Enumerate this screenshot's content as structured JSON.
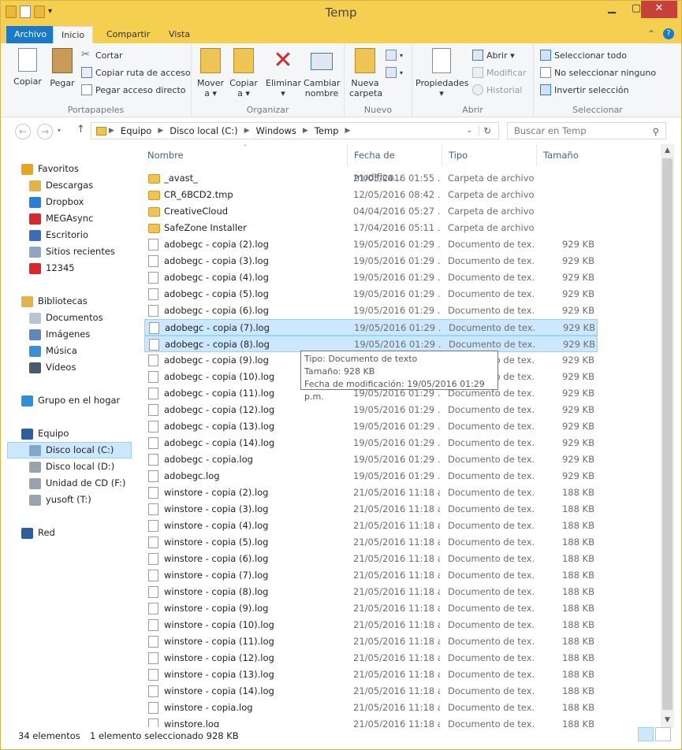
{
  "window": {
    "title": "Temp"
  },
  "tabs": [
    "Archivo",
    "Inicio",
    "Compartir",
    "Vista"
  ],
  "ribbon": {
    "portapapeles": {
      "label": "Portapapeles",
      "copiar": "Copiar",
      "pegar": "Pegar",
      "cortar": "Cortar",
      "copiar_ruta": "Copiar ruta de acceso",
      "pegar_acceso": "Pegar acceso directo"
    },
    "organizar": {
      "label": "Organizar",
      "mover": "Mover",
      "mover_a": "a ▾",
      "copiar": "Copiar",
      "copiar_a": "a ▾",
      "eliminar": "Eliminar",
      "eliminar_arrow": "▾",
      "cambiar": "Cambiar",
      "nombre": "nombre"
    },
    "nuevo": {
      "label": "Nuevo",
      "nueva": "Nueva",
      "carpeta": "carpeta"
    },
    "abrir": {
      "label": "Abrir",
      "propiedades": "Propiedades",
      "abrir": "Abrir ▾",
      "modificar": "Modificar",
      "historial": "Historial"
    },
    "seleccionar": {
      "label": "Seleccionar",
      "todo": "Seleccionar todo",
      "ninguno": "No seleccionar ninguno",
      "invertir": "Invertir selección"
    }
  },
  "address": {
    "crumbs": [
      "Equipo",
      "Disco local (C:)",
      "Windows",
      "Temp"
    ],
    "search_placeholder": "Buscar en Temp"
  },
  "nav": [
    {
      "label": "Favoritos",
      "icon": "star-icon",
      "color": "#e8a524"
    },
    {
      "label": "Descargas",
      "icon": "download-folder-icon",
      "color": "#e3b34a"
    },
    {
      "label": "Dropbox",
      "icon": "dropbox-icon",
      "color": "#2a7fd6"
    },
    {
      "label": "MEGAsync",
      "icon": "mega-icon",
      "color": "#d9272e"
    },
    {
      "label": "Escritorio",
      "icon": "desktop-icon",
      "color": "#3a6fb7"
    },
    {
      "label": "Sitios recientes",
      "icon": "recent-places-icon",
      "color": "#8fa6bf"
    },
    {
      "label": "12345",
      "icon": "mega-icon",
      "color": "#d9272e"
    },
    {
      "label": "Bibliotecas",
      "icon": "libraries-icon",
      "color": "#e3b34a"
    },
    {
      "label": "Documentos",
      "icon": "documents-icon",
      "color": "#b9c4d0"
    },
    {
      "label": "Imágenes",
      "icon": "pictures-icon",
      "color": "#5f87b8"
    },
    {
      "label": "Música",
      "icon": "music-icon",
      "color": "#3d8ed8"
    },
    {
      "label": "Vídeos",
      "icon": "videos-icon",
      "color": "#4a5a6a"
    },
    {
      "label": "Grupo en el hogar",
      "icon": "homegroup-icon",
      "color": "#2f8fd2"
    },
    {
      "label": "Equipo",
      "icon": "computer-icon",
      "color": "#2c5f9e"
    },
    {
      "label": "Disco local (C:)",
      "icon": "drive-c-icon",
      "color": "#7fa8c9"
    },
    {
      "label": "Disco local (D:)",
      "icon": "drive-icon",
      "color": "#9aa3ab"
    },
    {
      "label": "Unidad de CD (F:)",
      "icon": "cd-drive-icon",
      "color": "#9aa3ab"
    },
    {
      "label": "yusoft  (T:)",
      "icon": "network-drive-icon",
      "color": "#9aa3ab"
    },
    {
      "label": "Red",
      "icon": "network-icon",
      "color": "#2c5f9e"
    }
  ],
  "columns": {
    "name": "Nombre",
    "date": "Fecha de modifica...",
    "type": "Tipo",
    "size": "Tamaño"
  },
  "files": [
    {
      "name": "_avast_",
      "date": "21/05/2016 01:55 ...",
      "type": "Carpeta de archivos",
      "size": "",
      "kind": "folder"
    },
    {
      "name": "CR_6BCD2.tmp",
      "date": "12/05/2016 08:42 ...",
      "type": "Carpeta de archivos",
      "size": "",
      "kind": "folder"
    },
    {
      "name": "CreativeCloud",
      "date": "04/04/2016 05:27 ...",
      "type": "Carpeta de archivos",
      "size": "",
      "kind": "folder"
    },
    {
      "name": "SafeZone Installer",
      "date": "17/04/2016 05:11 ...",
      "type": "Carpeta de archivos",
      "size": "",
      "kind": "folder"
    },
    {
      "name": "adobegc - copia (2).log",
      "date": "19/05/2016 01:29 ...",
      "type": "Documento de tex...",
      "size": "929 KB",
      "kind": "file"
    },
    {
      "name": "adobegc - copia (3).log",
      "date": "19/05/2016 01:29 ...",
      "type": "Documento de tex...",
      "size": "929 KB",
      "kind": "file"
    },
    {
      "name": "adobegc - copia (4).log",
      "date": "19/05/2016 01:29 ...",
      "type": "Documento de tex...",
      "size": "929 KB",
      "kind": "file"
    },
    {
      "name": "adobegc - copia (5).log",
      "date": "19/05/2016 01:29 ...",
      "type": "Documento de tex...",
      "size": "929 KB",
      "kind": "file"
    },
    {
      "name": "adobegc - copia (6).log",
      "date": "19/05/2016 01:29 ...",
      "type": "Documento de tex...",
      "size": "929 KB",
      "kind": "file"
    },
    {
      "name": "adobegc - copia (7).log",
      "date": "19/05/2016 01:29 ...",
      "type": "Documento de tex...",
      "size": "929 KB",
      "kind": "file"
    },
    {
      "name": "adobegc - copia (8).log",
      "date": "19/05/2016 01:29 ...",
      "type": "Documento de tex...",
      "size": "929 KB",
      "kind": "file"
    },
    {
      "name": "adobegc - copia (9).log",
      "date": "19/05/2016 01:29 ...",
      "type": "Documento de tex...",
      "size": "929 KB",
      "kind": "file"
    },
    {
      "name": "adobegc - copia (10).log",
      "date": "19/05/2016 01:29 ...",
      "type": "Documento de tex...",
      "size": "929 KB",
      "kind": "file"
    },
    {
      "name": "adobegc - copia (11).log",
      "date": "19/05/2016 01:29 ...",
      "type": "Documento de tex...",
      "size": "929 KB",
      "kind": "file"
    },
    {
      "name": "adobegc - copia (12).log",
      "date": "19/05/2016 01:29 ...",
      "type": "Documento de tex...",
      "size": "929 KB",
      "kind": "file"
    },
    {
      "name": "adobegc - copia (13).log",
      "date": "19/05/2016 01:29 ...",
      "type": "Documento de tex...",
      "size": "929 KB",
      "kind": "file"
    },
    {
      "name": "adobegc - copia (14).log",
      "date": "19/05/2016 01:29 ...",
      "type": "Documento de tex...",
      "size": "929 KB",
      "kind": "file"
    },
    {
      "name": "adobegc - copia.log",
      "date": "19/05/2016 01:29 ...",
      "type": "Documento de tex...",
      "size": "929 KB",
      "kind": "file"
    },
    {
      "name": "adobegc.log",
      "date": "19/05/2016 01:29 ...",
      "type": "Documento de tex...",
      "size": "929 KB",
      "kind": "file"
    },
    {
      "name": "winstore - copia (2).log",
      "date": "21/05/2016 11:18 a...",
      "type": "Documento de tex...",
      "size": "188 KB",
      "kind": "file"
    },
    {
      "name": "winstore - copia (3).log",
      "date": "21/05/2016 11:18 a...",
      "type": "Documento de tex...",
      "size": "188 KB",
      "kind": "file"
    },
    {
      "name": "winstore - copia (4).log",
      "date": "21/05/2016 11:18 a...",
      "type": "Documento de tex...",
      "size": "188 KB",
      "kind": "file"
    },
    {
      "name": "winstore - copia (5).log",
      "date": "21/05/2016 11:18 a...",
      "type": "Documento de tex...",
      "size": "188 KB",
      "kind": "file"
    },
    {
      "name": "winstore - copia (6).log",
      "date": "21/05/2016 11:18 a...",
      "type": "Documento de tex...",
      "size": "188 KB",
      "kind": "file"
    },
    {
      "name": "winstore - copia (7).log",
      "date": "21/05/2016 11:18 a...",
      "type": "Documento de tex...",
      "size": "188 KB",
      "kind": "file"
    },
    {
      "name": "winstore - copia (8).log",
      "date": "21/05/2016 11:18 a...",
      "type": "Documento de tex...",
      "size": "188 KB",
      "kind": "file"
    },
    {
      "name": "winstore - copia (9).log",
      "date": "21/05/2016 11:18 a...",
      "type": "Documento de tex...",
      "size": "188 KB",
      "kind": "file"
    },
    {
      "name": "winstore - copia (10).log",
      "date": "21/05/2016 11:18 a...",
      "type": "Documento de tex...",
      "size": "188 KB",
      "kind": "file"
    },
    {
      "name": "winstore - copia (11).log",
      "date": "21/05/2016 11:18 a...",
      "type": "Documento de tex...",
      "size": "188 KB",
      "kind": "file"
    },
    {
      "name": "winstore - copia (12).log",
      "date": "21/05/2016 11:18 a...",
      "type": "Documento de tex...",
      "size": "188 KB",
      "kind": "file"
    },
    {
      "name": "winstore - copia (13).log",
      "date": "21/05/2016 11:18 a...",
      "type": "Documento de tex...",
      "size": "188 KB",
      "kind": "file"
    },
    {
      "name": "winstore - copia (14).log",
      "date": "21/05/2016 11:18 a...",
      "type": "Documento de tex...",
      "size": "188 KB",
      "kind": "file"
    },
    {
      "name": "winstore - copia.log",
      "date": "21/05/2016 11:18 a...",
      "type": "Documento de tex...",
      "size": "188 KB",
      "kind": "file"
    },
    {
      "name": "winstore.log",
      "date": "21/05/2016 11:18 a...",
      "type": "Documento de tex...",
      "size": "188 KB",
      "kind": "file"
    }
  ],
  "selected_rows": [
    "adobegc - copia (7).log",
    "adobegc - copia (8).log"
  ],
  "tooltip": {
    "tipo": "Tipo: Documento de texto",
    "tamano": "Tamaño: 928 KB",
    "fecha": "Fecha de modificación: 19/05/2016 01:29 p.m."
  },
  "status": {
    "count": "34 elementos",
    "selected": "1 elemento seleccionado  928 KB"
  }
}
